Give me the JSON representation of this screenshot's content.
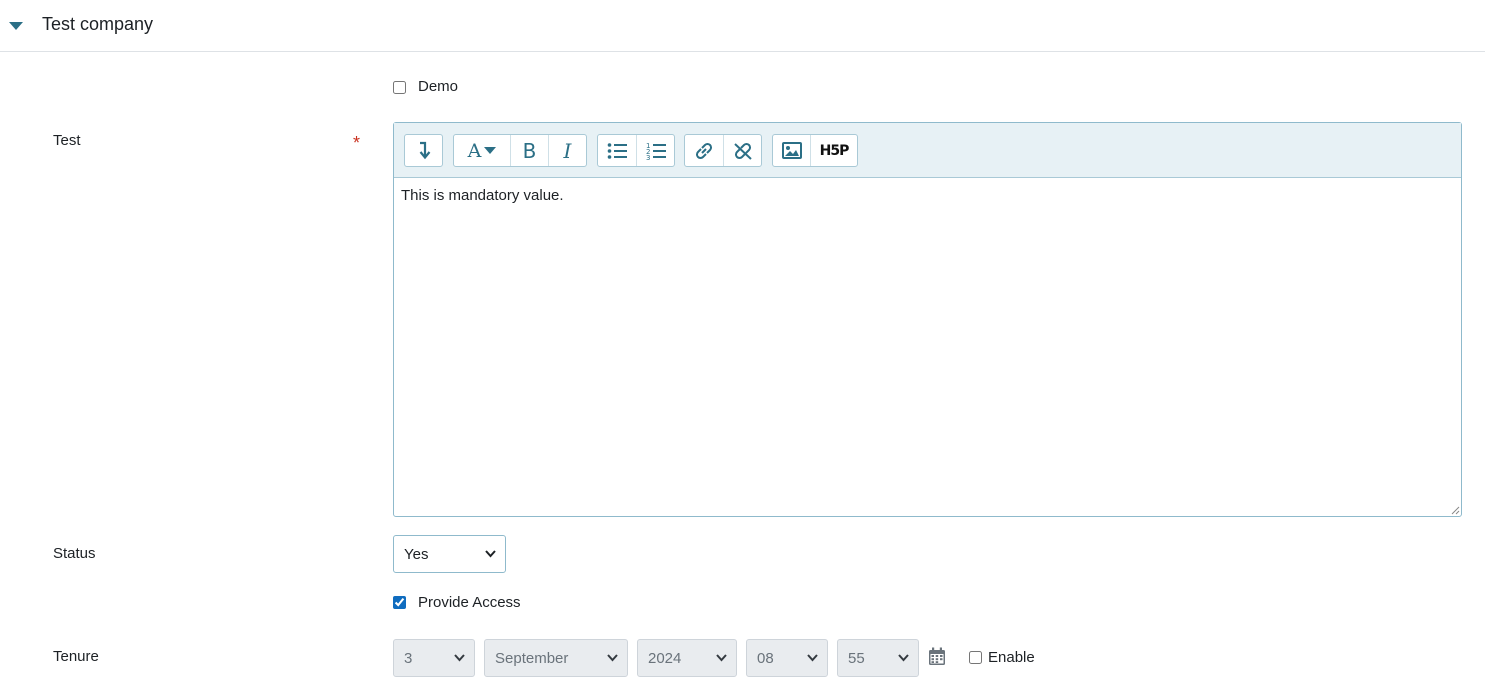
{
  "section": {
    "title": "Test company"
  },
  "demo": {
    "label": "Demo",
    "checked": false
  },
  "test_field": {
    "label": "Test",
    "required_marker": "*",
    "content": "This is mandatory value.",
    "toolbar": {
      "buttons": [
        {
          "name": "show-more-icon"
        },
        {
          "name": "font-style-icon"
        },
        {
          "name": "bold-icon"
        },
        {
          "name": "italic-icon"
        },
        {
          "name": "unordered-list-icon"
        },
        {
          "name": "ordered-list-icon"
        },
        {
          "name": "link-icon"
        },
        {
          "name": "unlink-icon"
        },
        {
          "name": "image-icon"
        },
        {
          "name": "h5p-icon"
        }
      ],
      "h5p_text": "H5P",
      "bold_text": "B",
      "italic_text": "I",
      "font_text": "A"
    }
  },
  "status": {
    "label": "Status",
    "value": "Yes"
  },
  "provide_access": {
    "label": "Provide Access",
    "checked": true
  },
  "tenure": {
    "label": "Tenure",
    "day": "3",
    "month": "September",
    "year": "2024",
    "hour": "08",
    "minute": "55",
    "enable_label": "Enable",
    "enable_checked": false
  },
  "colors": {
    "accent": "#2b6f86",
    "required": "#ca3120",
    "toolbar_bg": "#e7f1f5"
  }
}
